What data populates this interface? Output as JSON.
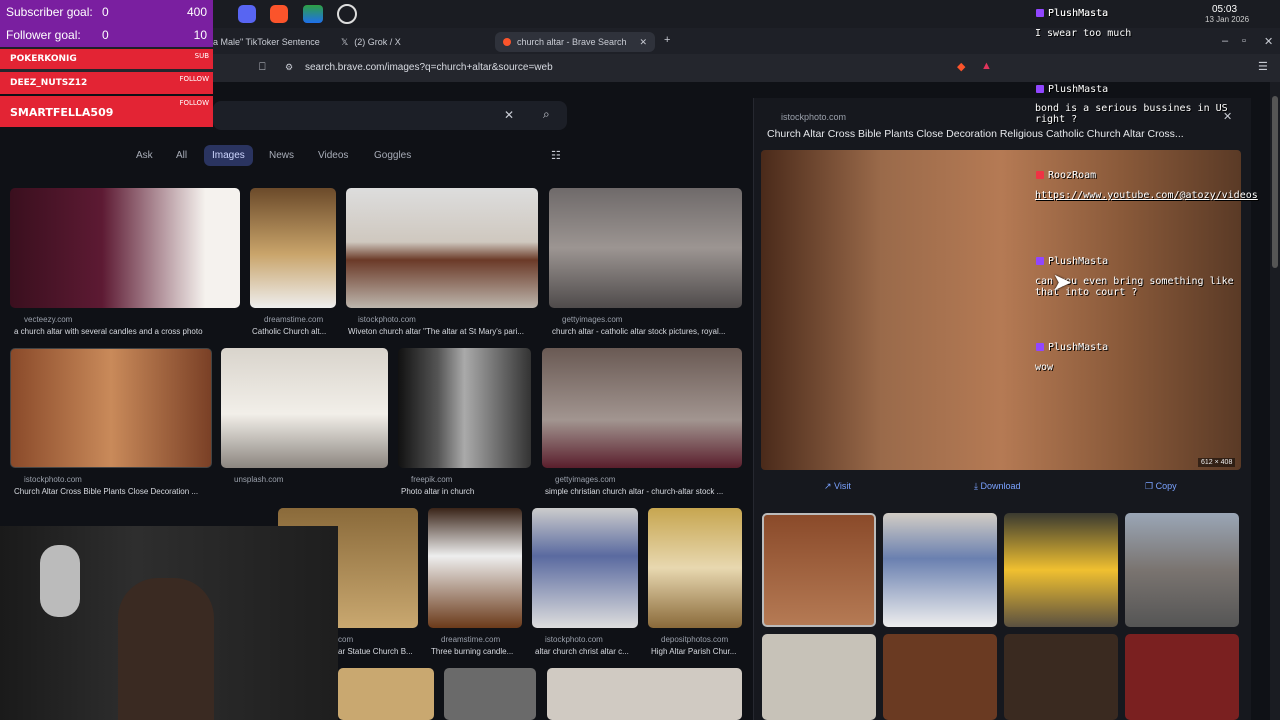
{
  "overlay": {
    "subscriber_goal": {
      "label": "Subscriber goal:",
      "current": "0",
      "target": "400"
    },
    "follower_goal": {
      "label": "Follower goal:",
      "current": "0",
      "target": "10"
    },
    "alerts": [
      {
        "name": "POKERKONIG",
        "tag": "SUB"
      },
      {
        "name": "DEEZ_NUTSZ12",
        "tag": "FOLLOW"
      },
      {
        "name": "SMARTFELLA509",
        "tag": "FOLLOW"
      }
    ]
  },
  "system": {
    "time": "05:03",
    "date": "13 Jan 2026",
    "tray_user": "PlushMasta"
  },
  "tabs": [
    {
      "label": "a Male\" TikToker Sentence"
    },
    {
      "label": "(2) Grok / X"
    },
    {
      "label": "church altar - Brave Search"
    }
  ],
  "url": "search.brave.com/images?q=church+altar&source=web",
  "search_nav": [
    "Ask",
    "All",
    "Images",
    "News",
    "Videos",
    "Goggles"
  ],
  "results_row1": [
    {
      "src": "vecteezy.com",
      "cap": "a church altar with several candles and a cross photo"
    },
    {
      "src": "dreamstime.com",
      "cap": "Catholic Church alt..."
    },
    {
      "src": "istockphoto.com",
      "cap": "Wiveton church altar \"The altar at St Mary's pari..."
    },
    {
      "src": "gettyimages.com",
      "cap": "church altar - catholic altar stock pictures, royal..."
    }
  ],
  "results_row2": [
    {
      "src": "istockphoto.com",
      "cap": "Church Altar Cross Bible Plants Close Decoration ..."
    },
    {
      "src": "unsplash.com",
      "cap": ""
    },
    {
      "src": "freepik.com",
      "cap": "Photo altar in church"
    },
    {
      "src": "gettyimages.com",
      "cap": "simple christian church altar - church-altar stock ..."
    }
  ],
  "results_row3": [
    {
      "src": "com",
      "cap": "ar Statue Church B..."
    },
    {
      "src": "dreamstime.com",
      "cap": "Three burning candle..."
    },
    {
      "src": "istockphoto.com",
      "cap": "altar church christ altar c..."
    },
    {
      "src": "depositphotos.com",
      "cap": "High Altar Parish Chur..."
    }
  ],
  "preview": {
    "source": "istockphoto.com",
    "title": "Church Altar Cross Bible Plants Close Decoration Religious Catholic Church Altar Cross...",
    "dimensions": "612 × 408",
    "actions": [
      "Visit",
      "Download",
      "Copy"
    ]
  },
  "chat": [
    {
      "user": "PlushMasta",
      "text": "I swear too much"
    },
    {
      "user": "PlushMasta",
      "text": "bond is a serious bussines in US right ?"
    },
    {
      "user": "RoozRoam",
      "text": "https://www.youtube.com/@atozy/videos"
    },
    {
      "user": "PlushMasta",
      "text": "can you even bring something like that into court ?"
    },
    {
      "user": "PlushMasta",
      "text": "wow"
    }
  ]
}
